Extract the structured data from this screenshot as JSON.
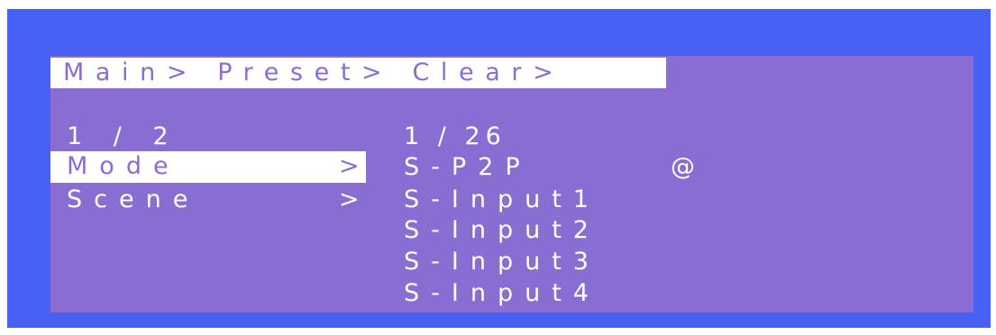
{
  "breadcrumb": "Main> Preset> Clear>",
  "left_menu": {
    "page_indicator": "1 / 2",
    "items": [
      {
        "label": "Mode",
        "arrow": ">",
        "selected": true
      },
      {
        "label": "Scene",
        "arrow": ">",
        "selected": false
      }
    ]
  },
  "right_list": {
    "page_indicator": "1 / 26",
    "items": [
      {
        "label": "S-P2P",
        "marker": "@"
      },
      {
        "label": "S-Input1",
        "marker": ""
      },
      {
        "label": "S-Input2",
        "marker": ""
      },
      {
        "label": "S-Input3",
        "marker": ""
      },
      {
        "label": "S-Input4",
        "marker": ""
      }
    ]
  },
  "colors": {
    "frame": "#4760f4",
    "screen": "#8a6dd2",
    "highlight": "#ffffff"
  }
}
